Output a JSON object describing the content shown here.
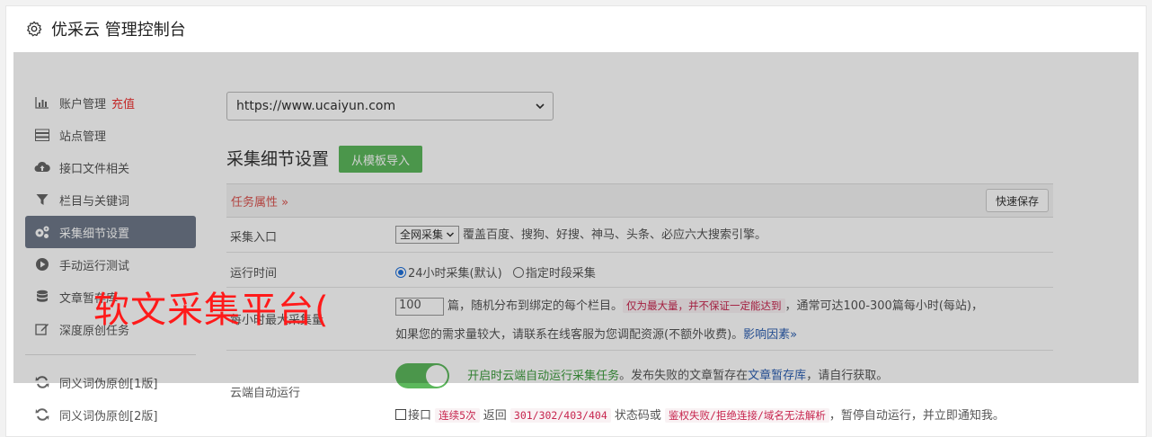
{
  "header": {
    "title": "优采云 管理控制台",
    "icon": "gear-icon"
  },
  "sidebar": {
    "items": [
      {
        "label": "账户管理",
        "tag": "充值",
        "icon": "bar-chart-icon"
      },
      {
        "label": "站点管理",
        "icon": "server-icon"
      },
      {
        "label": "接口文件相关",
        "icon": "cloud-upload-icon"
      },
      {
        "label": "栏目与关键词",
        "icon": "filter-icon"
      },
      {
        "label": "采集细节设置",
        "icon": "cogs-icon",
        "active": true
      },
      {
        "label": "手动运行测试",
        "icon": "play-circle-icon"
      },
      {
        "label": "文章暂存库",
        "icon": "database-icon"
      },
      {
        "label": "深度原创任务",
        "icon": "edit-icon"
      },
      {
        "label": "同义词伪原创[1版]",
        "icon": "refresh-icon"
      },
      {
        "label": "同义词伪原创[2版]",
        "icon": "refresh-icon"
      }
    ]
  },
  "main": {
    "url_select": "https://www.ucaiyun.com",
    "section_title": "采集细节设置",
    "import_button": "从模板导入",
    "panel_head": "任务属性 »",
    "quick_save": "快速保存",
    "rows": {
      "entry": {
        "label": "采集入口",
        "select": "全网采集",
        "desc": "覆盖百度、搜狗、好搜、神马、头条、必应六大搜索引擎。"
      },
      "time": {
        "label": "运行时间",
        "opt1": "24小时采集(默认)",
        "opt2": "指定时段采集"
      },
      "max": {
        "label": "每小时最大采集量",
        "value": "100",
        "text1": "篇，随机分布到绑定的每个栏目。",
        "pill": "仅为最大量，并不保证一定能达到",
        "text2": "，通常可达100-300篇每小时(每站)，",
        "text3": "如果您的需求量较大，请联系在线客服为您调配资源(不额外收费)。",
        "link": "影响因素»"
      },
      "cloud": {
        "label": "云端自动运行",
        "on_text": "开启时云端自动运行采集任务",
        "text1": "。发布失败的文章暂存在",
        "link": "文章暂存库",
        "text2": "，请自行获取。",
        "chk_label": "接口",
        "pill1": "连续5次",
        "t_return": "返回",
        "pill2": "301/302/403/404",
        "t_status": "状态码或",
        "pill3": "鉴权失败/拒绝连接/域名无法解析",
        "t_end": "，暂停自动运行，并立即通知我。"
      }
    }
  },
  "watermark": "软文采集平台("
}
